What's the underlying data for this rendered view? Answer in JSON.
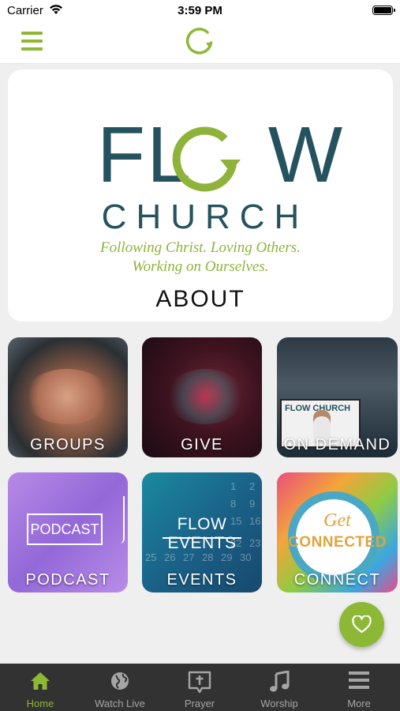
{
  "status_bar": {
    "carrier": "Carrier",
    "time": "3:59 PM"
  },
  "nav": {
    "menu_icon": "hamburger-menu-icon",
    "logo_icon": "flow-circle-arrow-logo-icon"
  },
  "about_card": {
    "brand_line1": "FL",
    "brand_line1_end": "W",
    "brand_line2": "CHURCH",
    "tagline_line1": "Following Christ. Loving Others.",
    "tagline_line2": "Working on Ourselves.",
    "label": "ABOUT"
  },
  "tiles": [
    {
      "label": "GROUPS"
    },
    {
      "label": "GIVE"
    },
    {
      "label": "ON DEMAND"
    },
    {
      "label": "PODCAST",
      "inner_text": "PODCAST"
    },
    {
      "label": "EVENTS",
      "inner_text": "FLOW EVENTS"
    },
    {
      "label": "CONNECT",
      "inner_text_1": "Get",
      "inner_text_2": "CONNECTED"
    }
  ],
  "on_demand_screen": "FLOW CHURCH",
  "calendar_numbers": [
    "1",
    "2",
    "8",
    "9",
    "15",
    "16",
    "22",
    "23",
    "25",
    "26",
    "27",
    "28",
    "29",
    "30"
  ],
  "fab": {
    "icon": "heart-icon"
  },
  "tab_bar": {
    "items": [
      {
        "label": "Home",
        "icon": "home-icon",
        "active": true
      },
      {
        "label": "Watch Live",
        "icon": "globe-icon",
        "active": false
      },
      {
        "label": "Prayer",
        "icon": "cross-chat-icon",
        "active": false
      },
      {
        "label": "Worship",
        "icon": "music-note-icon",
        "active": false
      },
      {
        "label": "More",
        "icon": "menu-lines-icon",
        "active": false
      }
    ]
  },
  "colors": {
    "accent_green": "#8cb836",
    "brand_teal": "#24525f",
    "tab_bar_bg": "#323232"
  }
}
